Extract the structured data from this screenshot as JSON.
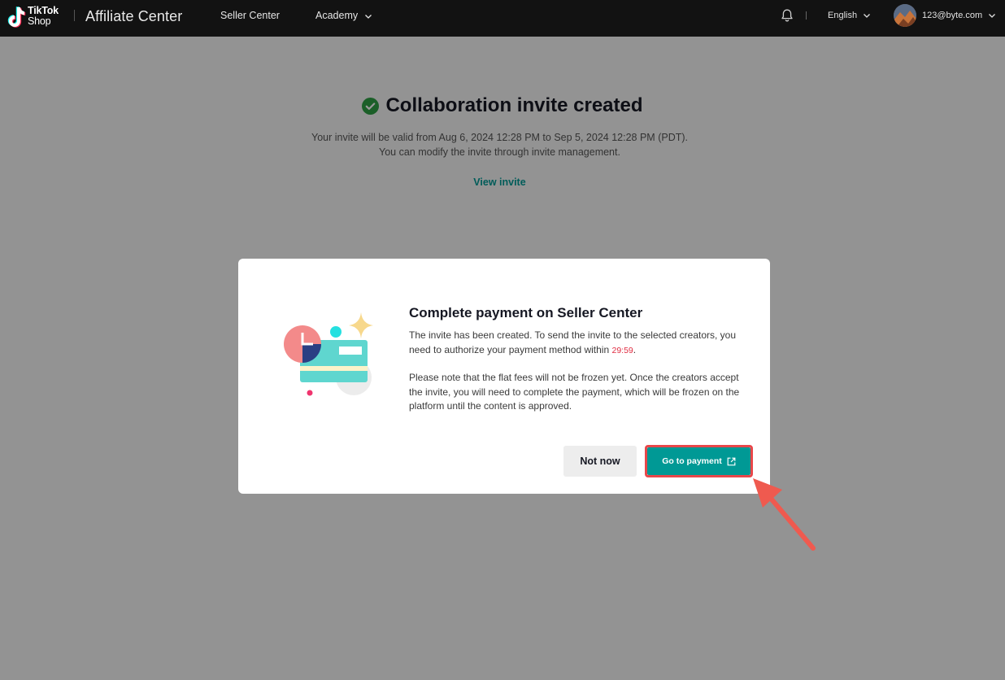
{
  "header": {
    "logo_line1": "TikTok",
    "logo_line2": "Shop",
    "app_title": "Affiliate Center",
    "nav": {
      "seller_center": "Seller Center",
      "academy": "Academy"
    },
    "language": "English",
    "account_email": "123@byte.com"
  },
  "page": {
    "success_title": "Collaboration invite created",
    "validity_text": "Your invite will be valid from Aug 6, 2024 12:28 PM to Sep 5, 2024 12:28 PM (PDT).",
    "modify_text": "You can modify the invite through invite management.",
    "view_invite_link": "View invite"
  },
  "modal": {
    "title": "Complete payment on Seller Center",
    "paragraph1": "The invite has been created. To send the invite to the selected creators, you need to authorize your payment method within ",
    "timer": "29:59",
    "paragraph1_end": ".",
    "paragraph2": "Please note that the flat fees will not be frozen yet. Once the creators accept the invite, you will need to complete the payment, which will be frozen on the platform until the content is approved.",
    "not_now_label": "Not now",
    "go_to_payment_label": "Go to payment"
  },
  "icons": [
    "tiktok-logo-icon",
    "chevron-down-icon",
    "bell-icon",
    "check-circle-icon",
    "payment-card-illustration",
    "external-link-icon",
    "annotation-arrow"
  ],
  "colors": {
    "accent": "#009995",
    "success": "#2e7d32",
    "timer": "#e02c41",
    "highlight": "#e8474a"
  }
}
